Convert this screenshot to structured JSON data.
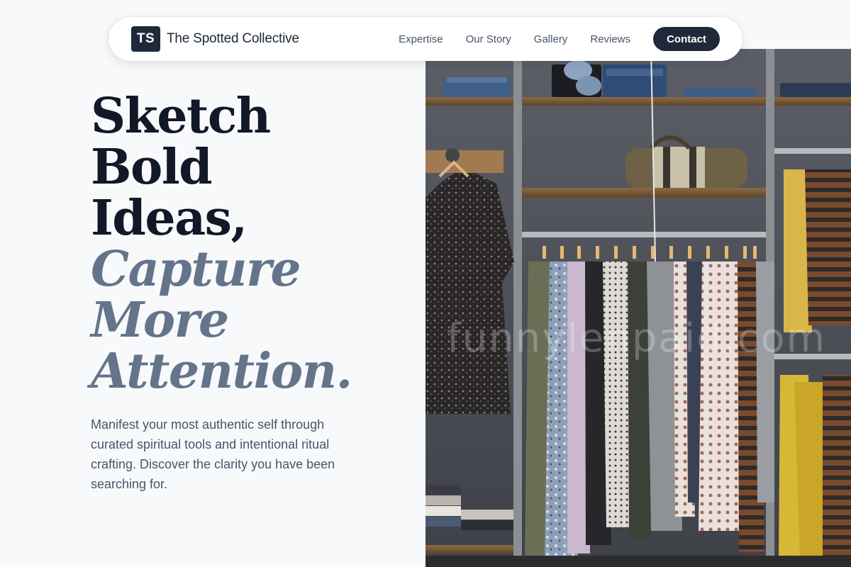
{
  "nav": {
    "logo_initials": "TS",
    "brand_name": "The Spotted Collective",
    "links": [
      "Expertise",
      "Our Story",
      "Gallery",
      "Reviews"
    ],
    "cta_label": "Contact"
  },
  "hero": {
    "headline_lines": [
      "Sketch",
      "Bold",
      "Ideas,"
    ],
    "headline_italic_lines": [
      "Capture",
      "More",
      "Attention."
    ],
    "subtext": "Manifest your most authentic self through curated spiritual tools and intentional ritual crafting. Discover the clarity you have been searching for."
  },
  "image": {
    "watermark": "funnylenpaid.com"
  },
  "colors": {
    "primary": "#1e2939",
    "muted": "#64748b",
    "background": "#f8f9fa"
  }
}
